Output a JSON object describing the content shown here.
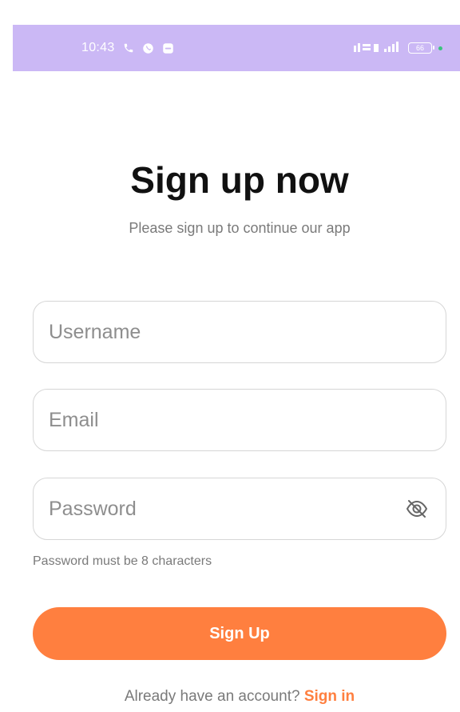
{
  "status_bar": {
    "time": "10:43",
    "left_icons": [
      "phone-icon",
      "whatsapp-icon",
      "message-icon"
    ],
    "right_text": "Vo LTE",
    "battery": "66",
    "background_color": "#cbb8f5"
  },
  "header": {
    "title": "Sign up now",
    "subtitle": "Please sign up to continue our app"
  },
  "form": {
    "username_placeholder": "Username",
    "email_placeholder": "Email",
    "password_placeholder": "Password",
    "password_hint": "Password must be 8 characters",
    "submit_label": "Sign Up"
  },
  "footer": {
    "prompt": "Already have an account?",
    "signin_label": "Sign in"
  },
  "colors": {
    "accent": "#ff7f3f",
    "title": "#111111",
    "muted": "#7a7a7a",
    "border": "#d6d6d6"
  },
  "icons": {
    "password_toggle": "eye-off-icon"
  }
}
